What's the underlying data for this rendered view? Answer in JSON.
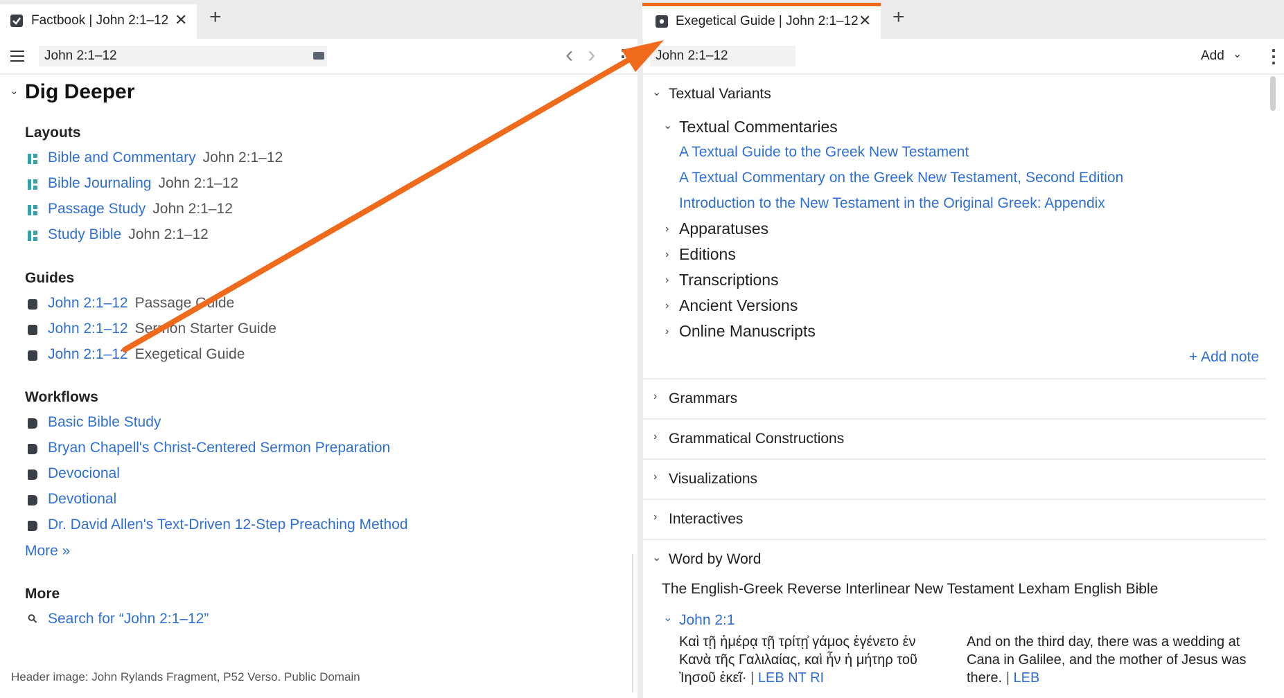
{
  "tabs": {
    "left": {
      "label": "Factbook | John 2:1–12",
      "close": "✕"
    },
    "right": {
      "label": "Exegetical Guide | John 2:1–12",
      "close": "✕"
    },
    "add": "+"
  },
  "left_toolbar": {
    "menu_icon": "hamburger-icon",
    "reference": "John 2:1–12",
    "keyboard_icon": "keyboard-icon",
    "back": "‹",
    "forward": "›",
    "more": "⋮"
  },
  "right_toolbar": {
    "reference": "John 2:1–12",
    "add_label": "Add",
    "more": "⋮"
  },
  "dig_deeper": {
    "title": "Dig Deeper",
    "layouts": {
      "title": "Layouts",
      "items": [
        {
          "label": "Bible and Commentary",
          "sub": "John 2:1–12"
        },
        {
          "label": "Bible Journaling",
          "sub": "John 2:1–12"
        },
        {
          "label": "Passage Study",
          "sub": "John 2:1–12"
        },
        {
          "label": "Study Bible",
          "sub": "John 2:1–12"
        }
      ]
    },
    "guides": {
      "title": "Guides",
      "items": [
        {
          "label": "John 2:1–12",
          "sub": "Passage Guide"
        },
        {
          "label": "John 2:1–12",
          "sub": "Sermon Starter Guide"
        },
        {
          "label": "John 2:1–12",
          "sub": "Exegetical Guide"
        }
      ]
    },
    "workflows": {
      "title": "Workflows",
      "items": [
        {
          "label": "Basic Bible Study"
        },
        {
          "label": "Bryan Chapell's Christ-Centered Sermon Preparation"
        },
        {
          "label": "Devocional"
        },
        {
          "label": "Devotional"
        },
        {
          "label": "Dr. David Allen's Text-Driven 12-Step Preaching Method"
        }
      ],
      "more": "More »"
    },
    "more": {
      "title": "More",
      "search": "Search for “John 2:1–12”"
    },
    "footer": "Header image: John Rylands Fragment, P52 Verso. Public Domain"
  },
  "exegetical": {
    "textual_variants": {
      "title": "Textual Variants",
      "commentaries": {
        "title": "Textual Commentaries",
        "links": [
          "A Textual Guide to the Greek New Testament",
          "A Textual Commentary on the Greek New Testament, Second Edition",
          "Introduction to the New Testament in the Original Greek: Appendix"
        ]
      },
      "collapsed": [
        "Apparatuses",
        "Editions",
        "Transcriptions",
        "Ancient Versions",
        "Online Manuscripts"
      ],
      "add_note": "+ Add note"
    },
    "sections": [
      "Grammars",
      "Grammatical Constructions",
      "Visualizations",
      "Interactives"
    ],
    "word_by_word": {
      "title": "Word by Word",
      "resource": "The English-Greek Reverse Interlinear New Testament Lexham English Bible",
      "verse": "John 2:1",
      "greek_lines": [
        "Καὶ τῇ ἡμέρᾳ τῇ τρίτῃ͐ γάμος ἐγένετο ἐν",
        "Κανὰ τῆς Γαλιλαίας, καὶ ἦν ἡ μήτηρ τοῦ",
        "Ἰησοῦ ἐκεῖ·"
      ],
      "greek_ref": "LEB NT RI",
      "english_lines": [
        "And on the third day, there was a wedding at",
        "Cana in Galilee, and the mother of Jesus was",
        "there."
      ],
      "english_ref": "LEB"
    }
  },
  "colors": {
    "accent_orange": "#f06a1c",
    "link_blue": "#2f6fd4",
    "layout_teal": "#3aa0a8"
  }
}
